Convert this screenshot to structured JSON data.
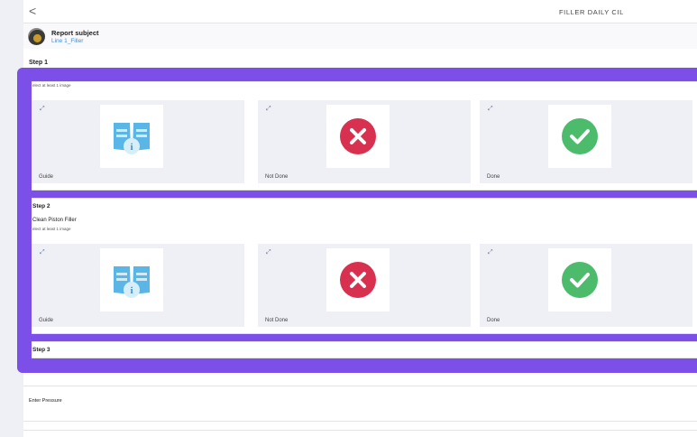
{
  "header": {
    "back_icon": "<",
    "title": "FILLER DAILY CIL"
  },
  "subject": {
    "title": "Report subject",
    "subtitle": "Line 1_Filler"
  },
  "steps": [
    {
      "label": "Step 1",
      "hint": "elect at least 1 image",
      "options": [
        {
          "label": "Guide",
          "icon": "guide-book-icon"
        },
        {
          "label": "Not Done",
          "icon": "red-x-icon"
        },
        {
          "label": "Done",
          "icon": "green-check-icon"
        }
      ]
    },
    {
      "label": "Step 2",
      "task": "Clean Piston Filler",
      "hint": "elect at least 1 image",
      "options": [
        {
          "label": "Guide",
          "icon": "guide-book-icon"
        },
        {
          "label": "Not Done",
          "icon": "red-x-icon"
        },
        {
          "label": "Done",
          "icon": "green-check-icon"
        }
      ]
    },
    {
      "label": "Step 3"
    }
  ],
  "pressure": {
    "label": "Enter Pressure"
  },
  "colors": {
    "accent_overlay": "#7b4fe8",
    "not_done": "#d8304f",
    "done": "#4cbb6c",
    "guide": "#5ab6e6",
    "link": "#3d8fd6"
  }
}
